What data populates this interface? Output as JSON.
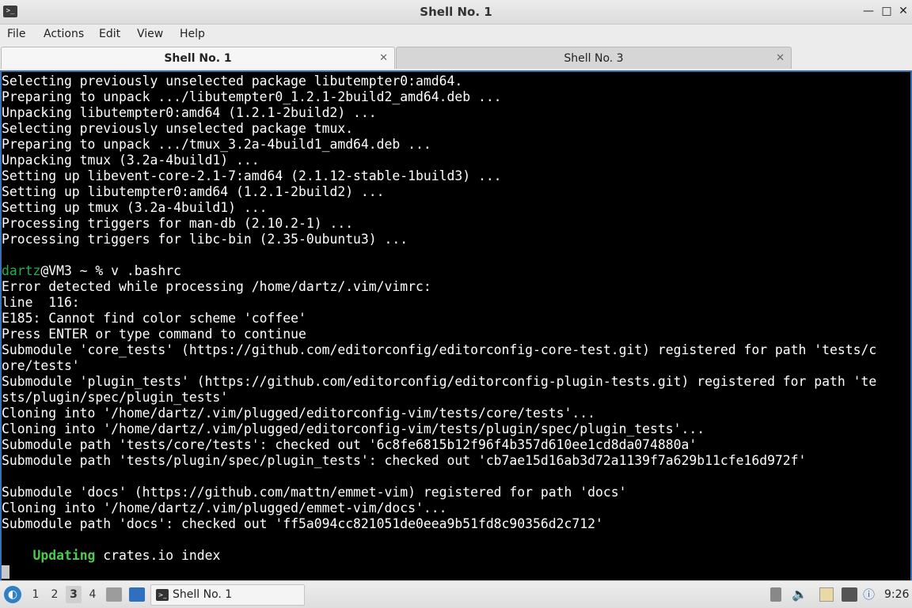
{
  "window": {
    "title": "Shell No. 1",
    "icon_glyph": ">_",
    "min_glyph": "—",
    "max_glyph": "□",
    "close_glyph": "✕"
  },
  "menu": [
    "File",
    "Actions",
    "Edit",
    "View",
    "Help"
  ],
  "tabs": [
    {
      "label": "Shell No. 1",
      "close": "✕",
      "active": true
    },
    {
      "label": "Shell No. 3",
      "close": "✕",
      "active": false
    }
  ],
  "terminal": {
    "lines": [
      "Selecting previously unselected package libutempter0:amd64.",
      "Preparing to unpack .../libutempter0_1.2.1-2build2_amd64.deb ...",
      "Unpacking libutempter0:amd64 (1.2.1-2build2) ...",
      "Selecting previously unselected package tmux.",
      "Preparing to unpack .../tmux_3.2a-4build1_amd64.deb ...",
      "Unpacking tmux (3.2a-4build1) ...",
      "Setting up libevent-core-2.1-7:amd64 (2.1.12-stable-1build3) ...",
      "Setting up libutempter0:amd64 (1.2.1-2build2) ...",
      "Setting up tmux (3.2a-4build1) ...",
      "Processing triggers for man-db (2.10.2-1) ...",
      "Processing triggers for libc-bin (2.35-0ubuntu3) ..."
    ],
    "prompt_user": "dartz",
    "prompt_rest": "@VM3 ~ % v .bashrc",
    "lines2": [
      "Error detected while processing /home/dartz/.vim/vimrc:",
      "line  116:",
      "E185: Cannot find color scheme 'coffee'",
      "Press ENTER or type command to continue",
      "Submodule 'core_tests' (https://github.com/editorconfig/editorconfig-core-test.git) registered for path 'tests/c",
      "ore/tests'",
      "Submodule 'plugin_tests' (https://github.com/editorconfig/editorconfig-plugin-tests.git) registered for path 'te",
      "sts/plugin/spec/plugin_tests'",
      "Cloning into '/home/dartz/.vim/plugged/editorconfig-vim/tests/core/tests'...",
      "Cloning into '/home/dartz/.vim/plugged/editorconfig-vim/tests/plugin/spec/plugin_tests'...",
      "Submodule path 'tests/core/tests': checked out '6c8fe6815b12f96f4b357d610ee1cd8da074880a'",
      "Submodule path 'tests/plugin/spec/plugin_tests': checked out 'cb7ae15d16ab3d72a1139f7a629b11cfe16d972f'",
      "",
      "Submodule 'docs' (https://github.com/mattn/emmet-vim) registered for path 'docs'",
      "Cloning into '/home/dartz/.vim/plugged/emmet-vim/docs'...",
      "Submodule path 'docs': checked out 'ff5a094cc821051de0eea9b51fd8c90356d2c712'",
      ""
    ],
    "status_keyword": "Updating",
    "status_rest": " crates.io index"
  },
  "taskbar": {
    "start_glyph": "◐",
    "workspaces": [
      "1",
      "2",
      "3",
      "4"
    ],
    "current_workspace": "3",
    "task_label": "Shell No. 1",
    "task_icon_glyph": ">_",
    "volume_glyph": "🔈",
    "info_glyph": "ⓘ",
    "clock": "9:26"
  }
}
